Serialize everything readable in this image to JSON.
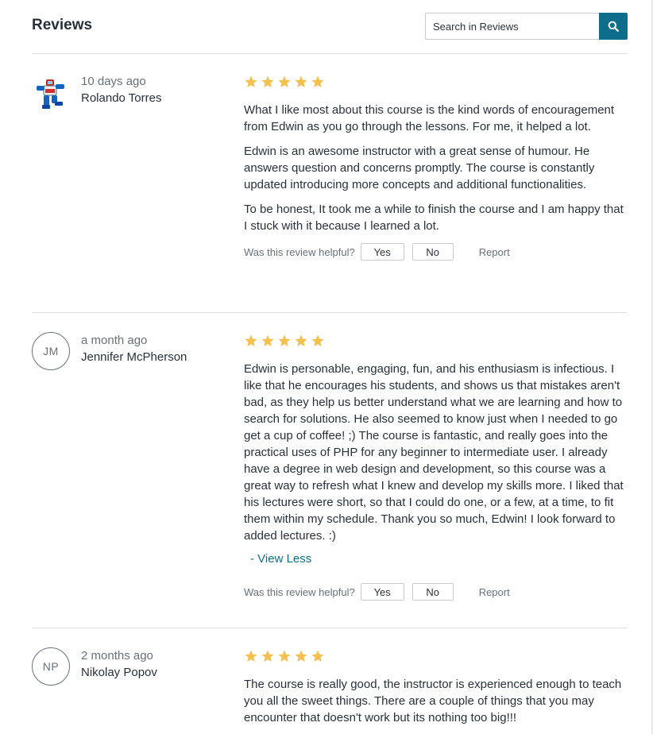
{
  "header": {
    "title": "Reviews",
    "search_placeholder": "Search in Reviews"
  },
  "helpful": {
    "label": "Was this review helpful?",
    "yes": "Yes",
    "no": "No",
    "report": "Report"
  },
  "reviews": [
    {
      "date": "10 days ago",
      "name": "Rolando Torres",
      "initials": "",
      "rating": 5,
      "paragraphs": [
        "What I like most about this course is the kind words of encouragement from Edwin as you go through the lessons. For me, it helped a lot.",
        "Edwin is an awesome instructor with a great sense of humour. He answers question and concerns promptly. The course is constantly updated introducing more concepts and additional functionalities.",
        "To be honest, It took me a while to finish the course and I am happy that I stuck with it because I learned a lot."
      ]
    },
    {
      "date": "a month ago",
      "name": "Jennifer McPherson",
      "initials": "JM",
      "rating": 5,
      "paragraphs": [
        "Edwin is personable, engaging, fun, and his enthusiasm is infectious. I like that he encourages his students, and shows us that mistakes aren't bad, as they help us better understand what we are learning and how to search for solutions. He also seemed to know just when I needed to go get a cup of coffee! ;) The course is fantastic, and really goes into the practical uses of PHP for any beginner to intermediate user. I already have a degree in web design and development, so this course was a great way to refresh what I knew and develop my skills more. I liked that his lectures were short, so that I could do one, or a few, at a time, to fit them within my schedule. Thank you so much, Edwin! I look forward to added lectures. :)"
      ],
      "view_less": "- View Less"
    },
    {
      "date": "2 months ago",
      "name": "Nikolay Popov",
      "initials": "NP",
      "rating": 5,
      "paragraphs": [
        "The course is really good, the instructor is experienced enough to teach you all the sweet things. There are a couple of things that you may encounter that doesn't work but its nothing too big!!!"
      ]
    }
  ],
  "colors": {
    "star": "#f4c150",
    "accent": "#0e6d8a",
    "text": "#29303b",
    "muted": "#686f7a"
  },
  "icons": {
    "search": "search-icon",
    "star": "star-icon"
  }
}
